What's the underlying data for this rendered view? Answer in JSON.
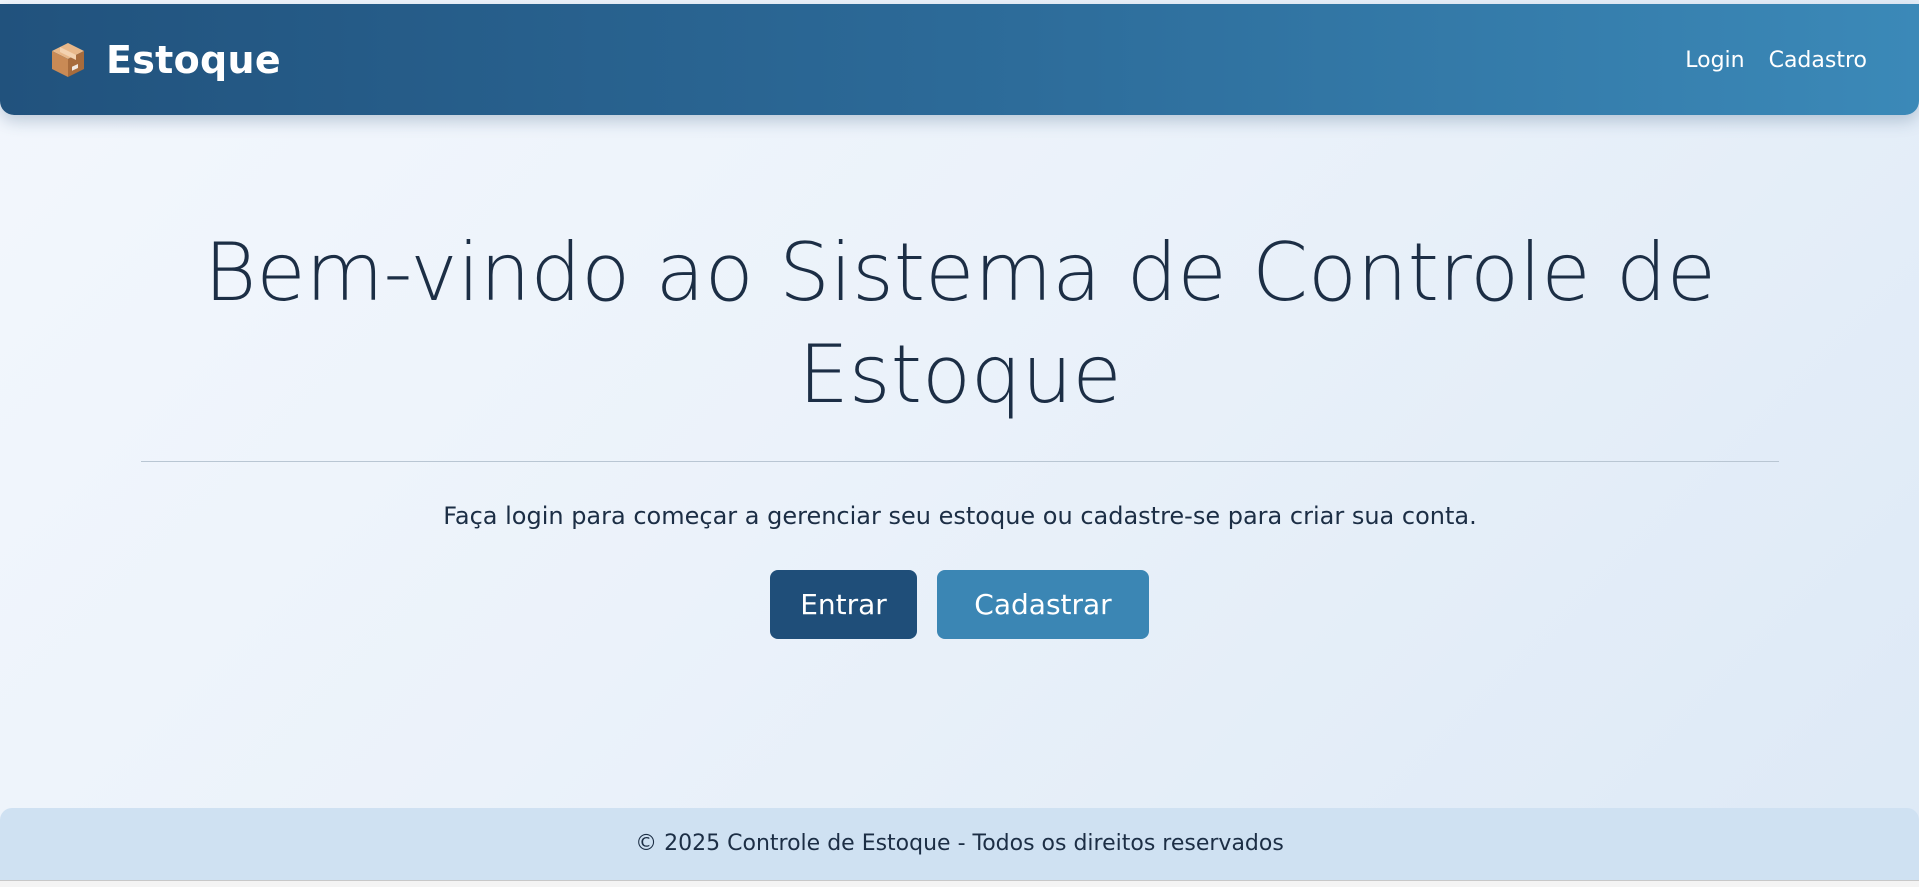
{
  "brand": {
    "name": "Estoque",
    "icon": "package-box-icon"
  },
  "nav": {
    "items": [
      {
        "label": "Login"
      },
      {
        "label": "Cadastro"
      }
    ]
  },
  "hero": {
    "title": "Bem-vindo ao Sistema de Controle de Estoque",
    "subtitle": "Faça login para começar a gerenciar seu estoque ou cadastre-se para criar sua conta."
  },
  "actions": {
    "primary_label": "Entrar",
    "secondary_label": "Cadastrar"
  },
  "footer": {
    "text": "© 2025 Controle de Estoque - Todos os direitos reservados"
  },
  "colors": {
    "navbar_start": "#21527d",
    "navbar_end": "#3b89b8",
    "primary_button": "#1f4e79",
    "secondary_button": "#3b86b4",
    "text_dark": "#1c2e45",
    "footer_bg": "#cfe1f2"
  }
}
